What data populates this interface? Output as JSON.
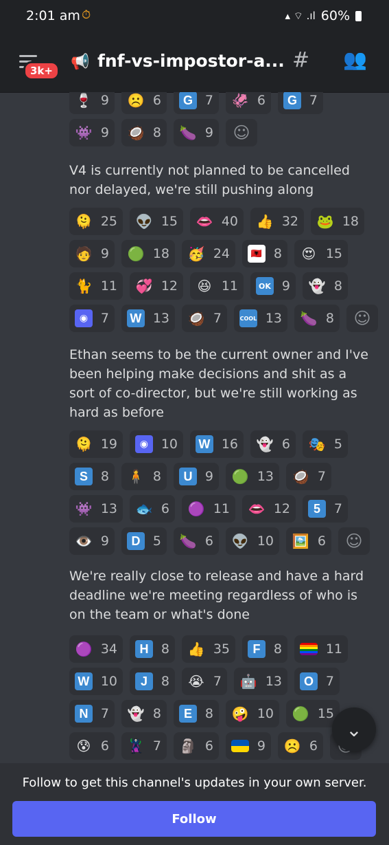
{
  "status": {
    "time": "2:01 am",
    "battery": "60%",
    "alarm_icon": "alarm-icon",
    "signal_icons": "wifi-signal-icons"
  },
  "header": {
    "badge": "3k+",
    "channel": "fnf-vs-impostor-a...",
    "threads_icon": "threads-icon",
    "members_icon": "members-icon"
  },
  "reaction_groups": [
    {
      "rows": [
        [
          {
            "e": "🍷",
            "c": "9"
          },
          {
            "e": "☹️",
            "c": "6"
          },
          {
            "e": "G",
            "t": "letter",
            "c": "7"
          },
          {
            "e": "🦑",
            "c": "6"
          },
          {
            "e": "G",
            "t": "letter",
            "c": "7"
          }
        ],
        [
          {
            "e": "👾",
            "c": "9"
          },
          {
            "e": "🥥",
            "c": "8"
          },
          {
            "e": "🍆",
            "c": "9"
          }
        ]
      ]
    },
    {
      "rows": [
        [
          {
            "e": "🫠",
            "c": "25"
          },
          {
            "e": "👽",
            "c": "15"
          },
          {
            "e": "👄",
            "c": "40"
          },
          {
            "e": "👍",
            "c": "32"
          },
          {
            "e": "🐸",
            "c": "18"
          }
        ],
        [
          {
            "e": "🧑",
            "c": "9"
          },
          {
            "e": "🟢",
            "c": "18"
          },
          {
            "e": "🥳",
            "c": "24"
          },
          {
            "e": "🇦🇱",
            "t": "flag",
            "c": "8"
          },
          {
            "e": "😍",
            "c": "15"
          }
        ],
        [
          {
            "e": "🐈",
            "c": "11"
          },
          {
            "e": "💞",
            "c": "12"
          },
          {
            "e": "😆",
            "c": "11"
          },
          {
            "e": "OK",
            "t": "ok",
            "c": "9"
          },
          {
            "e": "👻",
            "c": "8"
          }
        ],
        [
          {
            "e": "◉",
            "t": "dc",
            "c": "7"
          },
          {
            "e": "W",
            "t": "letter",
            "c": "13"
          },
          {
            "e": "🥥",
            "c": "7"
          },
          {
            "e": "COOL",
            "t": "cool",
            "c": "13"
          },
          {
            "e": "🍆",
            "c": "8"
          }
        ]
      ]
    },
    {
      "rows": [
        [
          {
            "e": "🫠",
            "c": "19"
          },
          {
            "e": "◉",
            "t": "dc",
            "c": "10"
          },
          {
            "e": "W",
            "t": "letter",
            "c": "16"
          },
          {
            "e": "👻",
            "c": "6"
          },
          {
            "e": "🎭",
            "c": "5"
          }
        ],
        [
          {
            "e": "S",
            "t": "letter",
            "c": "8"
          },
          {
            "e": "🧍",
            "c": "8"
          },
          {
            "e": "U",
            "t": "letter",
            "c": "9"
          },
          {
            "e": "🟢",
            "c": "13"
          },
          {
            "e": "🥥",
            "c": "7"
          }
        ],
        [
          {
            "e": "👾",
            "c": "13"
          },
          {
            "e": "🐟",
            "c": "6"
          },
          {
            "e": "🟣",
            "c": "11"
          },
          {
            "e": "👄",
            "c": "12"
          },
          {
            "e": "5",
            "t": "letter",
            "c": "7"
          }
        ],
        [
          {
            "e": "👁️",
            "c": "9"
          },
          {
            "e": "D",
            "t": "letter",
            "c": "5"
          },
          {
            "e": "🍆",
            "c": "6"
          },
          {
            "e": "👽",
            "c": "10"
          },
          {
            "e": "🖼️",
            "c": "6"
          }
        ]
      ]
    },
    {
      "rows": [
        [
          {
            "e": "🟣",
            "c": "34"
          },
          {
            "e": "H",
            "t": "letter",
            "c": "8"
          },
          {
            "e": "👍",
            "c": "35"
          },
          {
            "e": "F",
            "t": "letter",
            "c": "8"
          },
          {
            "e": "",
            "t": "pride",
            "c": "11"
          }
        ],
        [
          {
            "e": "W",
            "t": "letter",
            "c": "10"
          },
          {
            "e": "J",
            "t": "letter",
            "c": "8"
          },
          {
            "e": "😭",
            "c": "7"
          },
          {
            "e": "🤖",
            "c": "13"
          },
          {
            "e": "O",
            "t": "letter",
            "c": "7"
          }
        ],
        [
          {
            "e": "N",
            "t": "letter",
            "c": "7"
          },
          {
            "e": "👻",
            "c": "8"
          },
          {
            "e": "E",
            "t": "letter",
            "c": "8"
          },
          {
            "e": "🤪",
            "c": "10"
          },
          {
            "e": "🟢",
            "c": "15"
          }
        ],
        [
          {
            "e": "😰",
            "c": "6"
          },
          {
            "e": "🦹",
            "c": "7"
          },
          {
            "e": "🗿",
            "c": "6"
          },
          {
            "e": "",
            "t": "ua",
            "c": "9"
          },
          {
            "e": "☹️",
            "c": "6"
          }
        ]
      ]
    }
  ],
  "messages": [
    "V4 is currently not planned to be cancelled nor delayed, we're still pushing along",
    "Ethan seems to be the current owner and I've been helping make decisions and shit as a sort of co-director, but we're still working as hard as before",
    "We're really close to release and have a hard deadline we're meeting regardless of who is on the team or what's done"
  ],
  "footer": {
    "text": "Follow to get this channel's updates in your own server.",
    "button": "Follow"
  }
}
